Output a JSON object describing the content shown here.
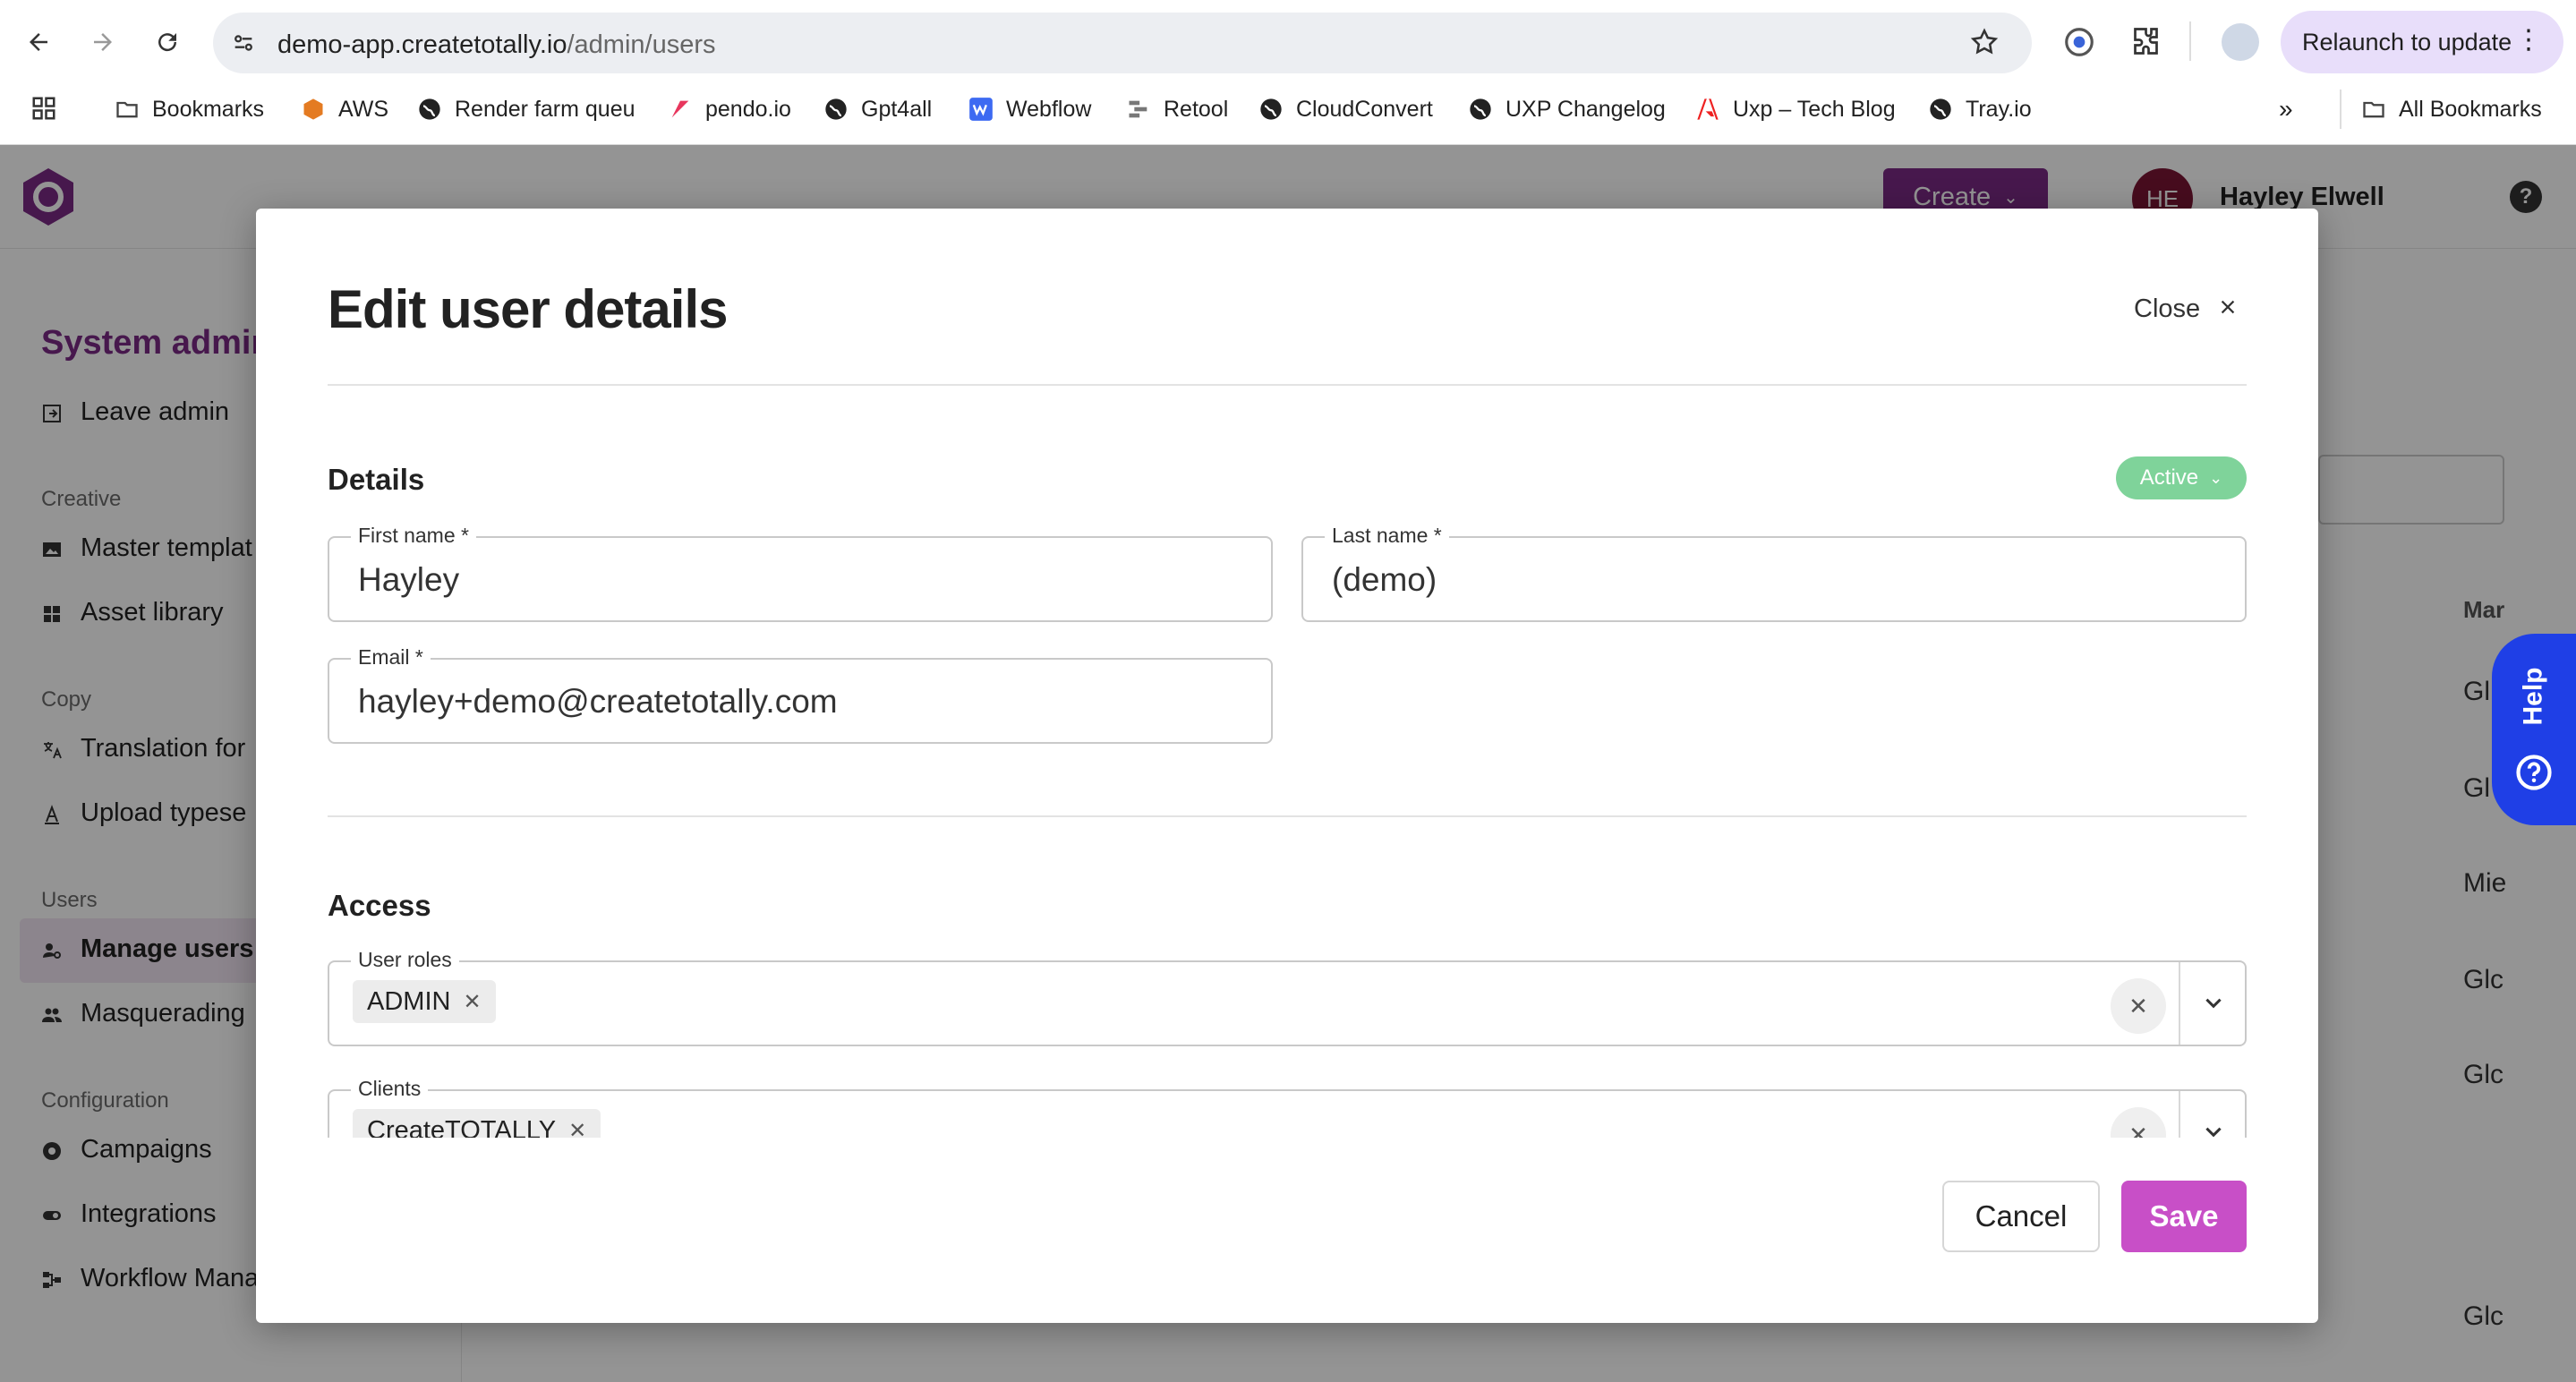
{
  "browser": {
    "url_host": "demo-app.createtotally.io",
    "url_path": "/admin/users",
    "relaunch_label": "Relaunch to update",
    "bookmarks": [
      {
        "label": "Bookmarks",
        "icon": "folder-icon"
      },
      {
        "label": "AWS",
        "icon": "aws-icon"
      },
      {
        "label": "Render farm queu",
        "icon": "globe-icon"
      },
      {
        "label": "pendo.io",
        "icon": "pendo-icon"
      },
      {
        "label": "Gpt4all",
        "icon": "globe-icon"
      },
      {
        "label": "Webflow",
        "icon": "webflow-icon"
      },
      {
        "label": "Retool",
        "icon": "retool-icon"
      },
      {
        "label": "CloudConvert",
        "icon": "globe-icon"
      },
      {
        "label": "UXP Changelog",
        "icon": "globe-icon"
      },
      {
        "label": "Uxp – Tech Blog",
        "icon": "adobe-icon"
      },
      {
        "label": "Tray.io",
        "icon": "globe-icon"
      }
    ],
    "all_bookmarks_label": "All Bookmarks"
  },
  "app": {
    "create_label": "Create",
    "user_initials": "HE",
    "user_name": "Hayley Elwell",
    "sidebar": {
      "title": "System admin",
      "leave_admin": "Leave admin",
      "sections": [
        {
          "heading": "Creative",
          "items": [
            "Master templat",
            "Asset library"
          ]
        },
        {
          "heading": "Copy",
          "items": [
            "Translation for",
            "Upload typese"
          ]
        },
        {
          "heading": "Users",
          "items": [
            "Manage users",
            "Masquerading"
          ]
        },
        {
          "heading": "Configuration",
          "items": [
            "Campaigns",
            "Integrations",
            "Workflow Mana"
          ]
        }
      ]
    },
    "background_column_header": "Mar",
    "background_cells": [
      "Gl",
      "Gl",
      "Mie",
      "Glc",
      "Glc",
      "Glc"
    ],
    "help_tab_label": "Help"
  },
  "modal": {
    "title": "Edit user details",
    "close_label": "Close",
    "details_heading": "Details",
    "status": "Active",
    "first_name_label": "First name *",
    "first_name_value": "Hayley",
    "last_name_label": "Last name *",
    "last_name_value": "(demo)",
    "email_label": "Email *",
    "email_value": "hayley+demo@createtotally.com",
    "access_heading": "Access",
    "user_roles_label": "User roles",
    "user_roles": [
      "ADMIN"
    ],
    "clients_label": "Clients",
    "clients": [
      "CreateTOTALLY"
    ],
    "cancel_label": "Cancel",
    "save_label": "Save"
  },
  "colors": {
    "brand_purple": "#7a2a86",
    "save_button": "#c84fc7",
    "active_badge": "#7fd39a",
    "help_tab": "#1f3fe6"
  }
}
